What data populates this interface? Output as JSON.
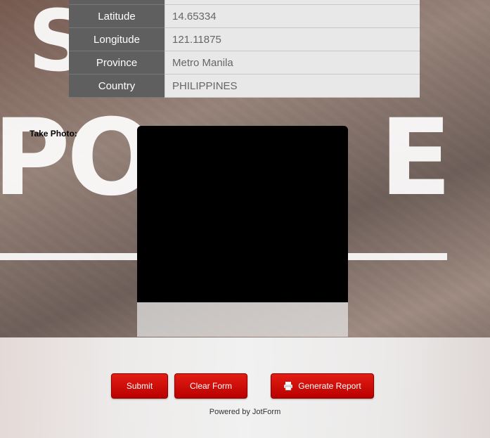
{
  "location": {
    "rows": [
      {
        "label": "",
        "value": ""
      },
      {
        "label": "Latitude",
        "value": "14.65334"
      },
      {
        "label": "Longitude",
        "value": "121.11875"
      },
      {
        "label": "Province",
        "value": "Metro Manila"
      },
      {
        "label": "Country",
        "value": "PHILIPPINES"
      }
    ]
  },
  "photo": {
    "label": "Take Photo:"
  },
  "background": {
    "letters": [
      "S",
      "P",
      "O",
      "E"
    ]
  },
  "buttons": {
    "submit": "Submit",
    "clear": "Clear Form",
    "report": "Generate Report"
  },
  "footer": {
    "powered_by": "Powered by JotForm"
  },
  "colors": {
    "button_red": "#cc1111",
    "label_bg": "#5f5f5f",
    "value_bg": "#e8e8e8"
  }
}
